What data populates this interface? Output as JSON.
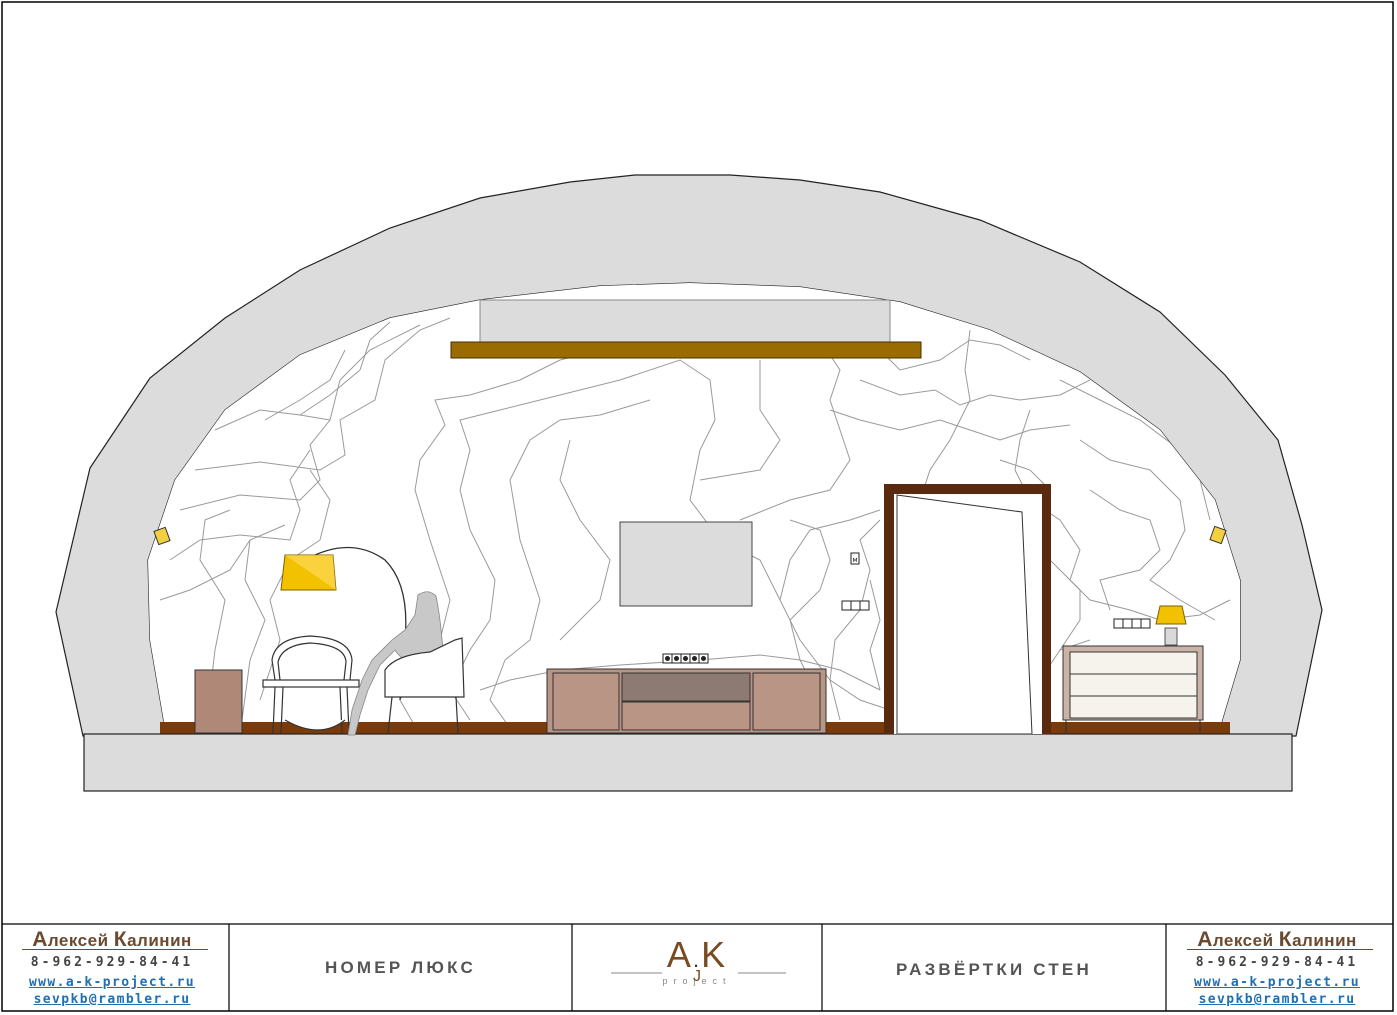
{
  "drawing": {
    "wall_treatment": "contour-line wall panel",
    "colors": {
      "arch": "#dcdcdc",
      "floor_strip": "#7a3a0a",
      "beam": "#9a6b00",
      "door_frame": "#5a2a10",
      "cabinet": "#b89585",
      "cabinet_drawer": "#8d7a72",
      "lamp_shade": "#f2c200",
      "dresser": "#f5f3ec"
    },
    "elements": [
      "arch-vault",
      "floor-slab",
      "ceiling-beam",
      "floor-lamp",
      "desk",
      "desk-chair",
      "armchair-with-figure",
      "side-cabinet",
      "tv-panel",
      "tv-unit",
      "socket-row",
      "light-switch",
      "door",
      "dresser",
      "table-lamp",
      "wall-sconce-left",
      "wall-sconce-right"
    ]
  },
  "title_block": {
    "left": {
      "author_first": "лексей ",
      "author_first_cap": "А",
      "author_last_cap": "К",
      "author_last": "алинин",
      "phone": "8-962-929-84-41",
      "website": "www.a-k-project.ru",
      "email": "sevpkb@rambler.ru"
    },
    "project_name": "НОМЕР ЛЮКС",
    "logo": {
      "main_a": "A",
      "main_k": "K",
      "sub": "project",
      "j": "J"
    },
    "sheet_name": "РАЗВЁРТКИ СТЕН",
    "right": {
      "author_first": "лексей ",
      "author_first_cap": "А",
      "author_last_cap": "К",
      "author_last": "алинин",
      "phone": "8-962-929-84-41",
      "website": "www.a-k-project.ru",
      "email": "sevpkb@rambler.ru"
    }
  }
}
